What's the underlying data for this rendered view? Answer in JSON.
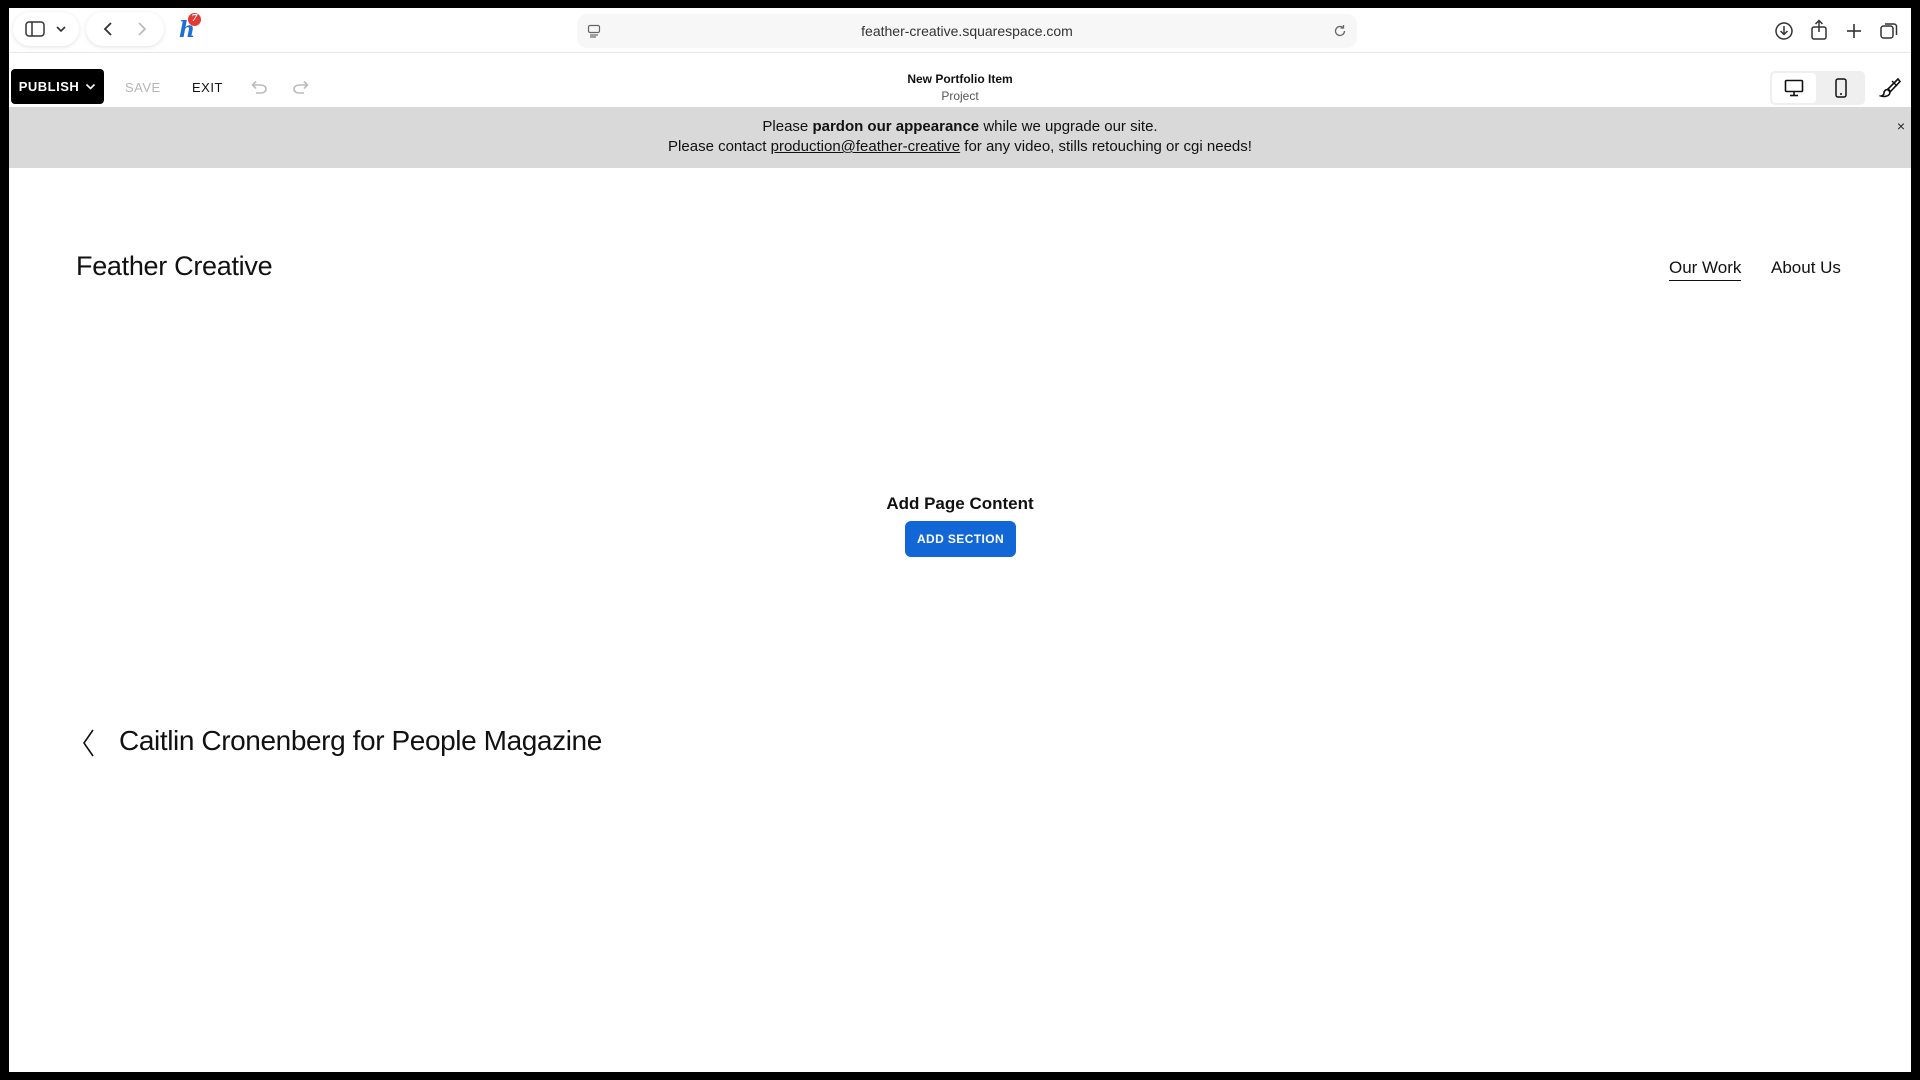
{
  "browser": {
    "url": "feather-creative.squarespace.com",
    "extension_badge": "7"
  },
  "editor": {
    "publish_label": "PUBLISH",
    "save_label": "SAVE",
    "exit_label": "EXIT",
    "page_title": "New Portfolio Item",
    "page_type": "Project"
  },
  "announcement": {
    "line1_pre": "Please ",
    "line1_bold": "pardon our appearance",
    "line1_post": " while we upgrade our site.",
    "line2_pre": "Please contact ",
    "line2_link": "production@feather-creative",
    "line2_post": " for any video, stills retouching or cgi needs!",
    "close_glyph": "×"
  },
  "site": {
    "title": "Feather Creative",
    "nav": [
      {
        "label": "Our Work",
        "active": true
      },
      {
        "label": "About Us",
        "active": false
      }
    ]
  },
  "content": {
    "empty_title": "Add Page Content",
    "add_section_label": "ADD SECTION"
  },
  "pagination": {
    "prev_title": "Caitlin Cronenberg for People Magazine"
  },
  "colors": {
    "accent_blue": "#1167d6",
    "announcement_bg": "#d9d9d9",
    "badge_red": "#e53935"
  }
}
